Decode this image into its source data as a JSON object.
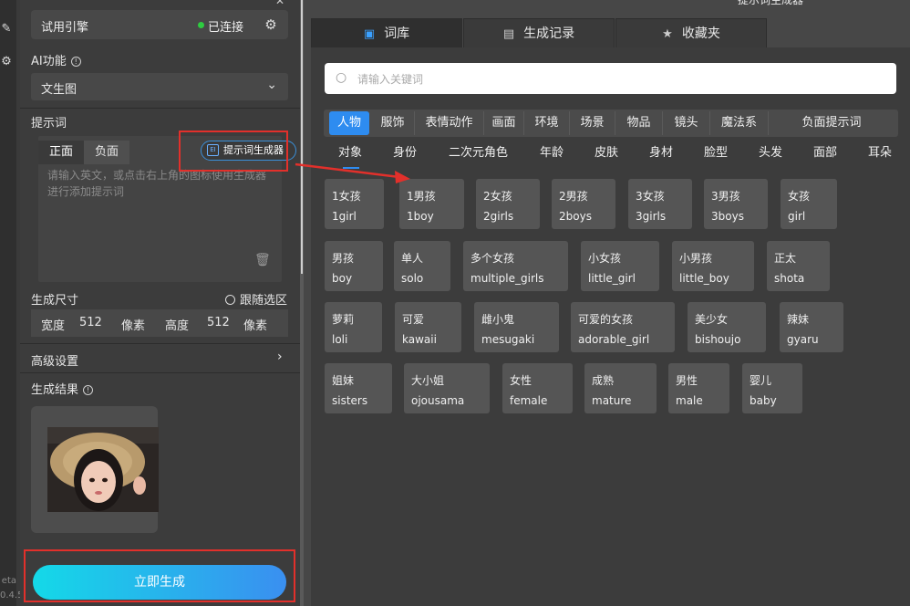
{
  "sidebar": {
    "icons": [
      "edit-icon",
      "gear-icon"
    ],
    "version_text": "eta\n0.4.5"
  },
  "engine": {
    "name": "试用引擎",
    "status": "已连接",
    "status_color": "#2ecc40"
  },
  "ai_function": {
    "label": "AI功能",
    "value": "文生图"
  },
  "prompt": {
    "label": "提示词",
    "tabs": [
      "正面",
      "负面"
    ],
    "generator_button": "提示词生成器",
    "placeholder": "请输入英文，或点击右上角的图标使用生成器进行添加提示词"
  },
  "size": {
    "label": "生成尺寸",
    "follow_label": "跟随选区",
    "width_label": "宽度",
    "width_value": "512",
    "width_unit": "像素",
    "height_label": "高度",
    "height_value": "512",
    "height_unit": "像素"
  },
  "advanced": {
    "label": "高级设置"
  },
  "result": {
    "label": "生成结果"
  },
  "generate_button": "立即生成",
  "right": {
    "title": "提示词生成器",
    "tabs": [
      "词库",
      "生成记录",
      "收藏夹"
    ],
    "search_placeholder": "请输入关键词",
    "categories": [
      "人物",
      "服饰",
      "表情动作",
      "画面",
      "环境",
      "场景",
      "物品",
      "镜头",
      "魔法系",
      "负面提示词"
    ],
    "active_category": "人物",
    "subcategories": [
      "对象",
      "身份",
      "二次元角色",
      "年龄",
      "皮肤",
      "身材",
      "脸型",
      "头发",
      "面部",
      "耳朵"
    ],
    "active_subcategory": "对象",
    "accent": "#2e8cf0",
    "chips": [
      {
        "zh": "1女孩",
        "en": "1girl"
      },
      {
        "zh": "1男孩",
        "en": "1boy"
      },
      {
        "zh": "2女孩",
        "en": "2girls"
      },
      {
        "zh": "2男孩",
        "en": "2boys"
      },
      {
        "zh": "3女孩",
        "en": "3girls"
      },
      {
        "zh": "3男孩",
        "en": "3boys"
      },
      {
        "zh": "女孩",
        "en": "girl"
      },
      {
        "zh": "男孩",
        "en": "boy"
      },
      {
        "zh": "单人",
        "en": "solo"
      },
      {
        "zh": "多个女孩",
        "en": "multiple_girls"
      },
      {
        "zh": "小女孩",
        "en": "little_girl"
      },
      {
        "zh": "小男孩",
        "en": "little_boy"
      },
      {
        "zh": "正太",
        "en": "shota"
      },
      {
        "zh": "萝莉",
        "en": "loli"
      },
      {
        "zh": "可爱",
        "en": "kawaii"
      },
      {
        "zh": "雌小鬼",
        "en": "mesugaki"
      },
      {
        "zh": "可爱的女孩",
        "en": "adorable_girl"
      },
      {
        "zh": "美少女",
        "en": "bishoujo"
      },
      {
        "zh": "辣妹",
        "en": "gyaru"
      },
      {
        "zh": "姐妹",
        "en": "sisters"
      },
      {
        "zh": "大小姐",
        "en": "ojousama"
      },
      {
        "zh": "女性",
        "en": "female"
      },
      {
        "zh": "成熟",
        "en": "mature"
      },
      {
        "zh": "男性",
        "en": "male"
      },
      {
        "zh": "婴儿",
        "en": "baby"
      }
    ]
  }
}
